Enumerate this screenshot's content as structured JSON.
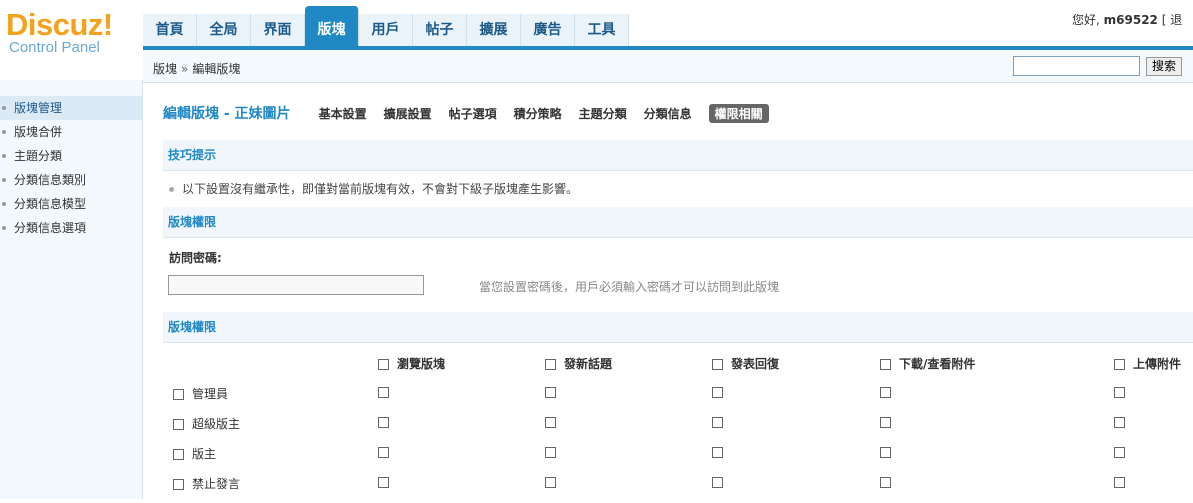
{
  "header": {
    "logo_main": "Discuz!",
    "logo_sub": "Control Panel",
    "greeting": "您好,",
    "username": "m69522",
    "logout": "[ 退"
  },
  "nav": {
    "tabs": [
      {
        "label": "首頁"
      },
      {
        "label": "全局"
      },
      {
        "label": "界面"
      },
      {
        "label": "版塊",
        "active": true
      },
      {
        "label": "用戶"
      },
      {
        "label": "帖子"
      },
      {
        "label": "擴展"
      },
      {
        "label": "廣告"
      },
      {
        "label": "工具"
      }
    ]
  },
  "breadcrumb": {
    "part1": "版塊",
    "separator": "»",
    "part2": "編輯版塊"
  },
  "search": {
    "value": "",
    "button": "搜索"
  },
  "sidebar": {
    "items": [
      {
        "label": "版塊管理",
        "active": true
      },
      {
        "label": "版塊合併"
      },
      {
        "label": "主題分類"
      },
      {
        "label": "分類信息類別"
      },
      {
        "label": "分類信息模型"
      },
      {
        "label": "分類信息選項"
      }
    ]
  },
  "page": {
    "title": "編輯版塊 - 正妹圖片",
    "subtabs": [
      {
        "label": "基本設置"
      },
      {
        "label": "擴展設置"
      },
      {
        "label": "帖子選項"
      },
      {
        "label": "積分策略"
      },
      {
        "label": "主題分類"
      },
      {
        "label": "分類信息"
      },
      {
        "label": "權限相關",
        "active": true
      }
    ]
  },
  "tips": {
    "heading": "技巧提示",
    "text": "以下設置沒有繼承性，即僅對當前版塊有效，不會對下級子版塊產生影響。"
  },
  "forum_perm": {
    "heading": "版塊權限",
    "password_label": "訪問密碼:",
    "password_value": "",
    "password_hint": "當您設置密碼後，用戶必須輸入密碼才可以訪問到此版塊"
  },
  "perm_table": {
    "heading": "版塊權限",
    "columns": [
      "瀏覽版塊",
      "發新話題",
      "發表回復",
      "下載/查看附件",
      "上傳附件"
    ],
    "rows": [
      "管理員",
      "超級版主",
      "版主",
      "禁止發言"
    ]
  }
}
